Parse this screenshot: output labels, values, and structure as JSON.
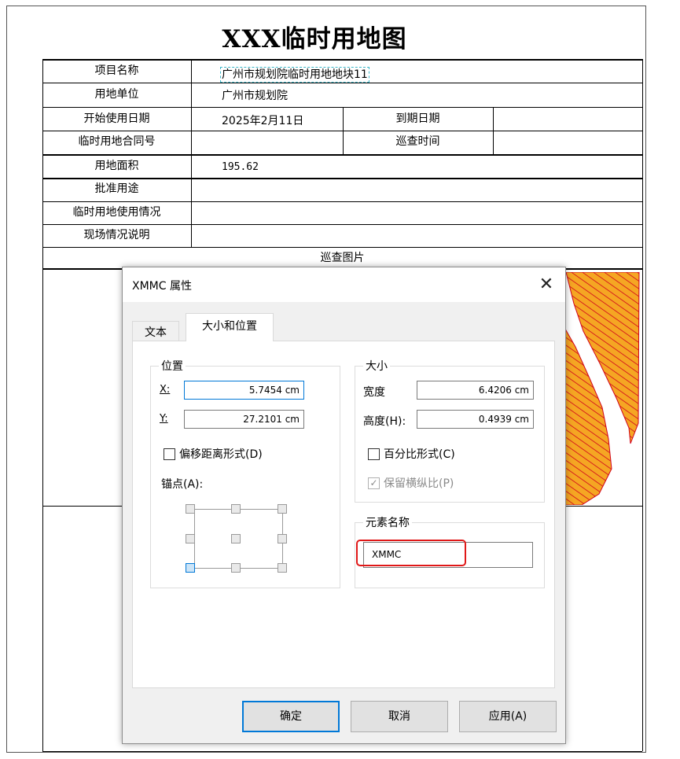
{
  "document": {
    "title": "XXX临时用地图",
    "rows": {
      "project_name_label": "项目名称",
      "project_name_value": "广州市规划院临时用地地块11",
      "unit_label": "用地单位",
      "unit_value": "广州市规划院",
      "start_date_label": "开始使用日期",
      "start_date_value": "2025年2月11日",
      "end_date_label": "到期日期",
      "end_date_value": "",
      "contract_label": "临时用地合同号",
      "contract_value": "",
      "inspect_time_label": "巡查时间",
      "inspect_time_value": "",
      "area_label": "用地面积",
      "area_value": "195.62",
      "approved_use_label": "批准用途",
      "usage_label": "临时用地使用情况",
      "site_desc_label": "现场情况说明",
      "photo_header": "巡查图片"
    }
  },
  "dialog": {
    "title": "XMMC 属性",
    "close_glyph": "✕",
    "tabs": [
      {
        "label": "文本",
        "active": false
      },
      {
        "label": "大小和位置",
        "active": true
      }
    ],
    "position": {
      "title": "位置",
      "x_label": "X:",
      "x_value": "5.7454 cm",
      "y_label": "Y:",
      "y_value": "27.2101 cm",
      "offset_checkbox_label": "偏移距离形式(D)",
      "offset_checked": false,
      "anchor_label": "锚点(A):",
      "selected_anchor": "bottom-left"
    },
    "size": {
      "title": "大小",
      "width_label": "宽度",
      "width_value": "6.4206 cm",
      "height_label": "高度(H):",
      "height_value": "0.4939 cm",
      "percent_checkbox_label": "百分比形式(C)",
      "percent_checked": false,
      "ratio_checkbox_label": "保留横纵比(P)",
      "ratio_checked": true,
      "ratio_disabled": true
    },
    "element": {
      "title": "元素名称",
      "name_value": "XMMC"
    },
    "buttons": {
      "ok": "确定",
      "cancel": "取消",
      "apply": "应用(A)"
    }
  },
  "colors": {
    "accent": "#0078d7",
    "highlight": "#e01818",
    "hatch_fill": "#f5a623",
    "hatch_line": "#d0021b"
  }
}
